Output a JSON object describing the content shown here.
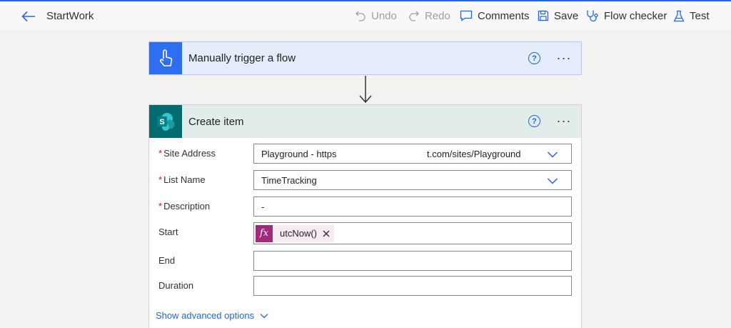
{
  "topbar": {
    "flow_name": "StartWork",
    "undo_label": "Undo",
    "redo_label": "Redo",
    "comments_label": "Comments",
    "save_label": "Save",
    "flow_checker_label": "Flow checker",
    "test_label": "Test"
  },
  "trigger": {
    "title": "Manually trigger a flow",
    "help": "?",
    "more": "···"
  },
  "action": {
    "title": "Create item",
    "help": "?",
    "more": "···",
    "fields": {
      "site_address": {
        "label": "Site Address",
        "required": "*",
        "value_part1": "Playground - https",
        "value_part2": "t.com/sites/Playground"
      },
      "list_name": {
        "label": "List Name",
        "required": "*",
        "value": "TimeTracking"
      },
      "description": {
        "label": "Description",
        "required": "*",
        "value": "-"
      },
      "start": {
        "label": "Start",
        "token_icon": "fx",
        "token_text": "utcNow()"
      },
      "end": {
        "label": "End",
        "value": ""
      },
      "duration": {
        "label": "Duration",
        "value": ""
      }
    },
    "advanced_label": "Show advanced options"
  },
  "colors": {
    "accent": "#2266e3",
    "trigger_tile": "#2e6ef0",
    "sharepoint_tile": "#036c70",
    "expression_token": "#a0297a",
    "required": "#a4262c"
  },
  "icons": [
    "back-arrow-icon",
    "undo-icon",
    "redo-icon",
    "comment-icon",
    "save-icon",
    "stethoscope-icon",
    "flask-icon",
    "touch-icon",
    "sharepoint-icon",
    "help-icon",
    "chevron-down-icon",
    "close-icon",
    "arrow-down-icon"
  ]
}
